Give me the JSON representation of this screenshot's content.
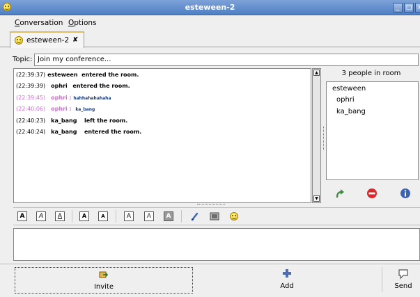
{
  "window": {
    "title": "esteween-2"
  },
  "menu": [
    {
      "label": "Conversation"
    },
    {
      "label": "Options"
    }
  ],
  "tabs": [
    {
      "label": "esteween-2",
      "close": "✘"
    }
  ],
  "topic": {
    "label": "Topic:",
    "value": "Join my conference..."
  },
  "messages": [
    {
      "time": "(22:39:37)",
      "nick": "esteween",
      "text": "entered the room.",
      "style": "system"
    },
    {
      "time": "(22:39:39)",
      "nick": "ophri",
      "text": "entered the room.",
      "style": "system"
    },
    {
      "time": "(22:39:45)",
      "nick": "ophri",
      "text": "hahhahahahaha",
      "style": "self"
    },
    {
      "time": "(22:40:06)",
      "nick": "ophri",
      "text": "ka_bang",
      "style": "self"
    },
    {
      "time": "(22:40:23)",
      "nick": "ka_bang",
      "text": "left the room.",
      "style": "system"
    },
    {
      "time": "(22:40:24)",
      "nick": "ka_bang",
      "text": "entered the room.",
      "style": "system"
    }
  ],
  "roster": {
    "count_label": "3 people in room",
    "members": [
      "esteween",
      "ophri",
      "ka_bang"
    ]
  },
  "format_toolbar": [
    {
      "icon": "bold-icon",
      "glyph": "A"
    },
    {
      "icon": "italic-icon",
      "glyph": "A"
    },
    {
      "icon": "underline-icon",
      "glyph": "A"
    },
    {
      "icon": "increase-font-icon",
      "glyph": "A"
    },
    {
      "icon": "decrease-font-icon",
      "glyph": "A"
    },
    {
      "icon": "font-face-icon",
      "glyph": "A"
    },
    {
      "icon": "foreground-color-icon",
      "glyph": "A"
    },
    {
      "icon": "background-color-icon",
      "glyph": "A"
    },
    {
      "icon": "link-icon",
      "glyph": ""
    },
    {
      "icon": "image-icon",
      "glyph": ""
    },
    {
      "icon": "smiley-icon",
      "glyph": ""
    }
  ],
  "bottom": {
    "invite": "Invite",
    "add": "Add",
    "send": "Send"
  },
  "colors": {
    "titlebar": "#5a88cb",
    "self_nick": "#d86ad8",
    "invite_icon": "#e4b64a",
    "add_icon": "#4d6fb0"
  }
}
